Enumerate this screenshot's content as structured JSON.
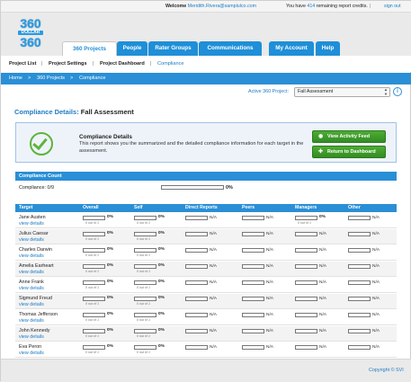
{
  "topbar": {
    "welcome_prefix": "Welcome",
    "user_email": "Meridith.Rivera@samplulco.com",
    "credits_prefix": "You have",
    "credits_count": "414",
    "credits_suffix": "remaining report credits.",
    "separator": "|",
    "signout_label": "sign out"
  },
  "logo": {
    "line1": "360",
    "line2": "DOLLAR",
    "line3": "360"
  },
  "tabs": [
    {
      "label": "360 Projects",
      "active": true
    },
    {
      "label": "People"
    },
    {
      "label": "Rater Groups"
    },
    {
      "label": "Communications"
    },
    {
      "label": "My Account"
    },
    {
      "label": "Help"
    }
  ],
  "subnav": {
    "items": [
      "Project List",
      "Project Settings",
      "Project Dashboard",
      "Compliance"
    ],
    "separator": "|"
  },
  "breadcrumb": {
    "items": [
      "Home",
      "360 Projects",
      "Compliance"
    ],
    "separator": ">"
  },
  "active_project": {
    "label": "Active 360 Project:",
    "selected": "Fall Assessment"
  },
  "info_icon_glyph": "i",
  "page": {
    "title_prefix": "Compliance Details:",
    "title_project": "Fall Assessment"
  },
  "details_box": {
    "title": "Compliance Details",
    "description": "This report shows you the summarized and the detailed compliance information for each target in the assessment.",
    "buttons": {
      "activity_feed": "View Activity Feed",
      "return_dashboard": "Return to Dashboard"
    },
    "icons": {
      "rss": "rss-icon",
      "plus": "plus-icon",
      "check": "check-circle-icon"
    },
    "colors": {
      "check": "#5fb33c",
      "button": "#3f9e2c"
    }
  },
  "compliance_count": {
    "header": "Compliance Count",
    "label": "Compliance: 0/9",
    "percent": "0%",
    "fraction": 0
  },
  "table": {
    "headers": [
      "Target",
      "Overall",
      "Self",
      "Direct Reports",
      "Peers",
      "Managers",
      "Other"
    ],
    "view_details_label": "view details",
    "rows": [
      {
        "name": "Jane Austen",
        "cells": [
          {
            "pct": "0%",
            "sub": "0 out of 1"
          },
          {
            "pct": "0%",
            "sub": "0 out of 1"
          },
          {
            "na": "N/A"
          },
          {
            "na": "N/A"
          },
          {
            "pct": "0%",
            "sub": "0 out of 1"
          },
          {
            "na": "N/A"
          }
        ]
      },
      {
        "name": "Julius Caesar",
        "cells": [
          {
            "pct": "0%",
            "sub": "0 out of 1"
          },
          {
            "pct": "0%",
            "sub": "0 out of 1"
          },
          {
            "na": "N/A"
          },
          {
            "na": "N/A"
          },
          {
            "na": "N/A"
          },
          {
            "na": "N/A"
          }
        ]
      },
      {
        "name": "Charles Darwin",
        "cells": [
          {
            "pct": "0%",
            "sub": "0 out of 1"
          },
          {
            "pct": "0%",
            "sub": "0 out of 1"
          },
          {
            "na": "N/A"
          },
          {
            "na": "N/A"
          },
          {
            "na": "N/A"
          },
          {
            "na": "N/A"
          }
        ]
      },
      {
        "name": "Amelia Earheart",
        "cells": [
          {
            "pct": "0%",
            "sub": "0 out of 1"
          },
          {
            "pct": "0%",
            "sub": "0 out of 1"
          },
          {
            "na": "N/A"
          },
          {
            "na": "N/A"
          },
          {
            "na": "N/A"
          },
          {
            "na": "N/A"
          }
        ]
      },
      {
        "name": "Anne Frank",
        "cells": [
          {
            "pct": "0%",
            "sub": "0 out of 1"
          },
          {
            "pct": "0%",
            "sub": "0 out of 1"
          },
          {
            "na": "N/A"
          },
          {
            "na": "N/A"
          },
          {
            "na": "N/A"
          },
          {
            "na": "N/A"
          }
        ]
      },
      {
        "name": "Sigmund Freud",
        "cells": [
          {
            "pct": "0%",
            "sub": "0 out of 1"
          },
          {
            "pct": "0%",
            "sub": "0 out of 1"
          },
          {
            "na": "N/A"
          },
          {
            "na": "N/A"
          },
          {
            "na": "N/A"
          },
          {
            "na": "N/A"
          }
        ]
      },
      {
        "name": "Thomas Jefferson",
        "cells": [
          {
            "pct": "0%",
            "sub": "0 out of 1"
          },
          {
            "pct": "0%",
            "sub": "0 out of 1"
          },
          {
            "na": "N/A"
          },
          {
            "na": "N/A"
          },
          {
            "na": "N/A"
          },
          {
            "na": "N/A"
          }
        ]
      },
      {
        "name": "John Kennedy",
        "cells": [
          {
            "pct": "0%",
            "sub": "0 out of 1"
          },
          {
            "pct": "0%",
            "sub": "0 out of 1"
          },
          {
            "na": "N/A"
          },
          {
            "na": "N/A"
          },
          {
            "na": "N/A"
          },
          {
            "na": "N/A"
          }
        ]
      },
      {
        "name": "Eva Peron",
        "cells": [
          {
            "pct": "0%",
            "sub": "0 out of 1"
          },
          {
            "pct": "0%",
            "sub": "0 out of 1"
          },
          {
            "na": "N/A"
          },
          {
            "na": "N/A"
          },
          {
            "na": "N/A"
          },
          {
            "na": "N/A"
          }
        ]
      }
    ]
  },
  "footer": {
    "copyright": "Copyright © SVI"
  },
  "colors": {
    "brand_blue": "#2a8fd6",
    "link_blue": "#1f7bc2",
    "green": "#3f9e2c"
  }
}
